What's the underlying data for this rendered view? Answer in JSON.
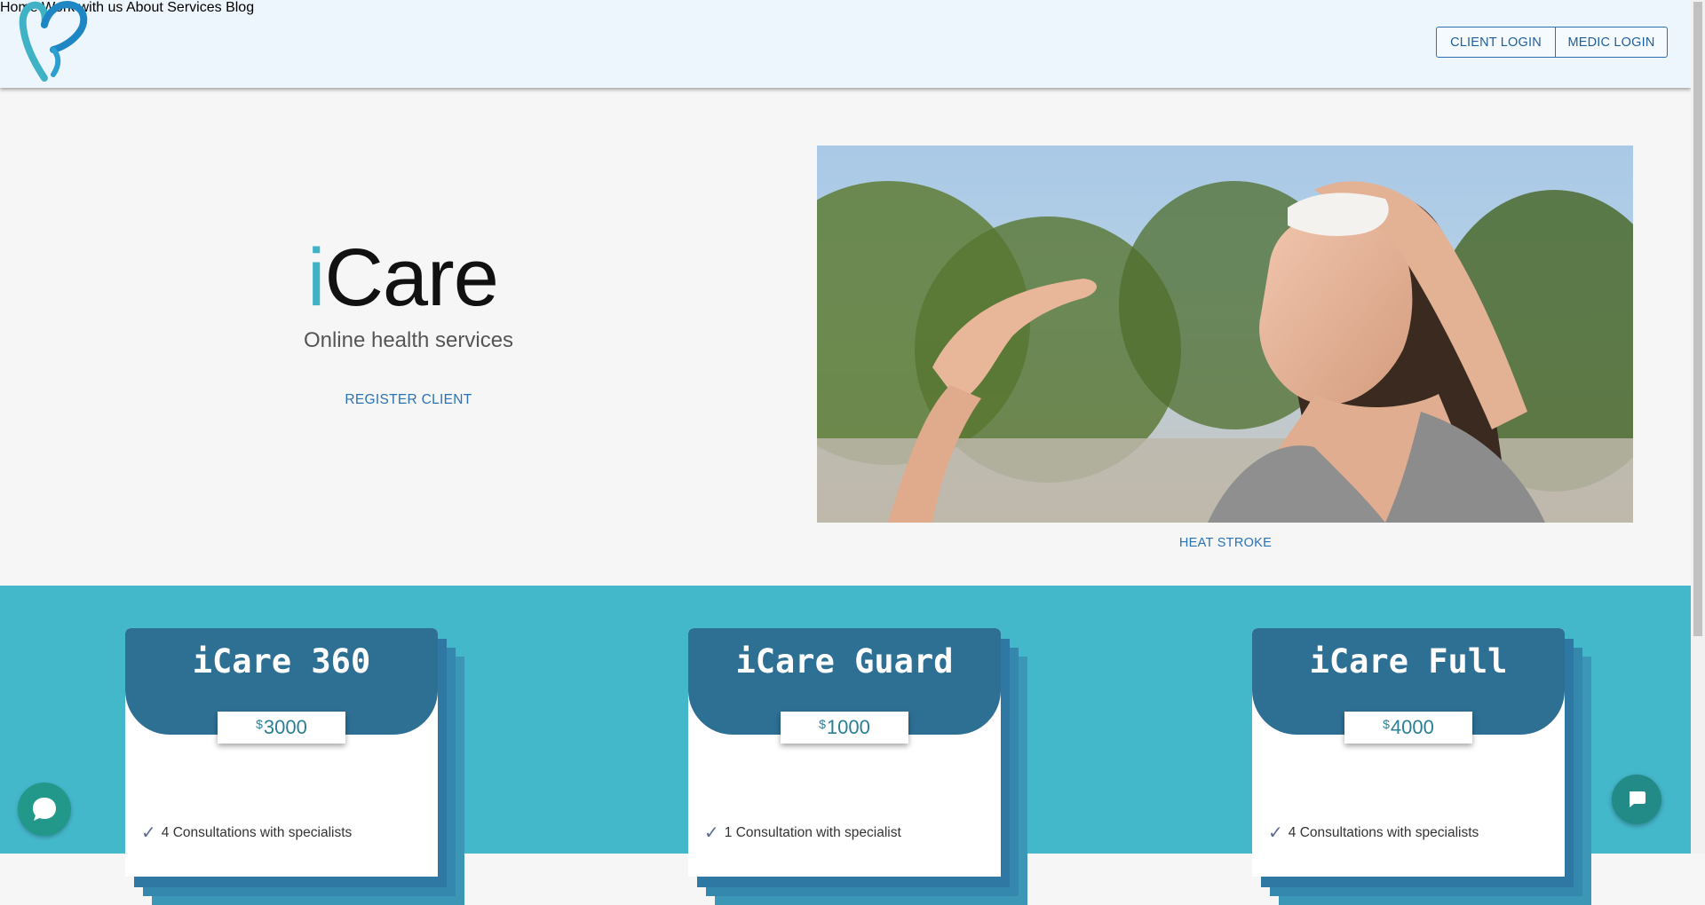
{
  "header": {
    "logo_icon": "heart-logo-icon",
    "nav": [
      "Home",
      "Work with us",
      "About",
      "Services",
      "Blog"
    ],
    "client_login": "CLIENT LOGIN",
    "medic_login": "MEDIC LOGIN"
  },
  "hero": {
    "title_i": "i",
    "title_rest": "Care",
    "subtitle": "Online health services",
    "register": "REGISTER CLIENT",
    "image_caption": "HEAT STROKE"
  },
  "plans": [
    {
      "name": "iCare 360",
      "currency": "$",
      "price": "3000",
      "feature": "4 Consultations with specialists"
    },
    {
      "name": "iCare Guard",
      "currency": "$",
      "price": "1000",
      "feature": "1 Consultation with specialist"
    },
    {
      "name": "iCare Full",
      "currency": "$",
      "price": "4000",
      "feature": "4 Consultations with specialists"
    }
  ],
  "colors": {
    "accent": "#3fb2c6",
    "plans_bg": "#44b8cb",
    "card_head": "#2e6f94",
    "link": "#2b72b5"
  },
  "widgets": {
    "chat_left_icon": "chat-bubble-icon",
    "chat_right_icon": "message-icon"
  }
}
